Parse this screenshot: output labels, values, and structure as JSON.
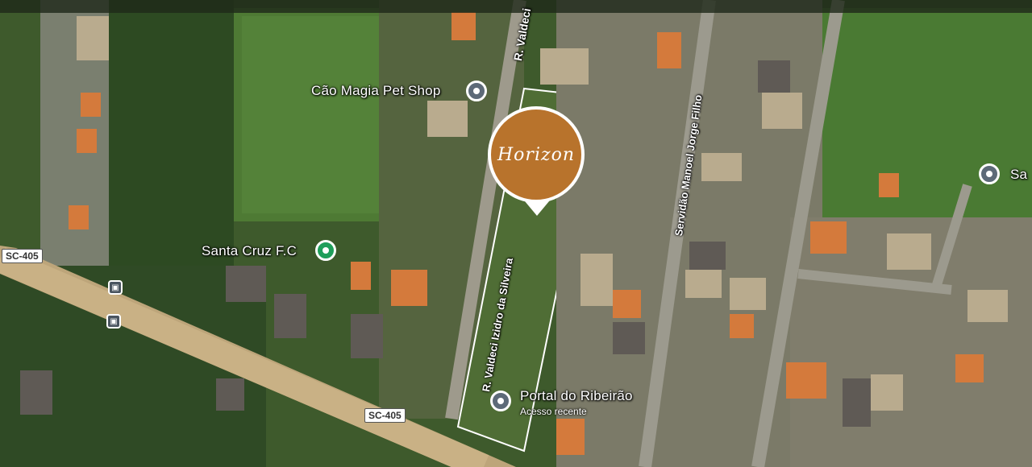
{
  "markers": {
    "pet_shop": "Cão Magia Pet Shop",
    "santa_cruz": "Santa Cruz F.C",
    "portal": "Portal do Ribeirão",
    "portal_sub": "Acesso recente",
    "right_edge": "Sa"
  },
  "streets": {
    "valdeci_top": "R. Valdeci",
    "valdeci_mid": "R. Valdeci Izidro da Silveira",
    "valdeci_low": "R. Valdeci Izidro da Silveira",
    "servidao": "Servidão Manoel Jorge Filho"
  },
  "highways": {
    "left": "SC-405",
    "bottom": "SC-405"
  },
  "logo": {
    "text": "Horizon",
    "color": "#b8732c"
  },
  "icons": {
    "pet_shop": "location-pin-icon",
    "santa_cruz": "green-place-pin-icon",
    "portal": "location-pin-icon",
    "bus_stops": "bus-stop-icon"
  }
}
